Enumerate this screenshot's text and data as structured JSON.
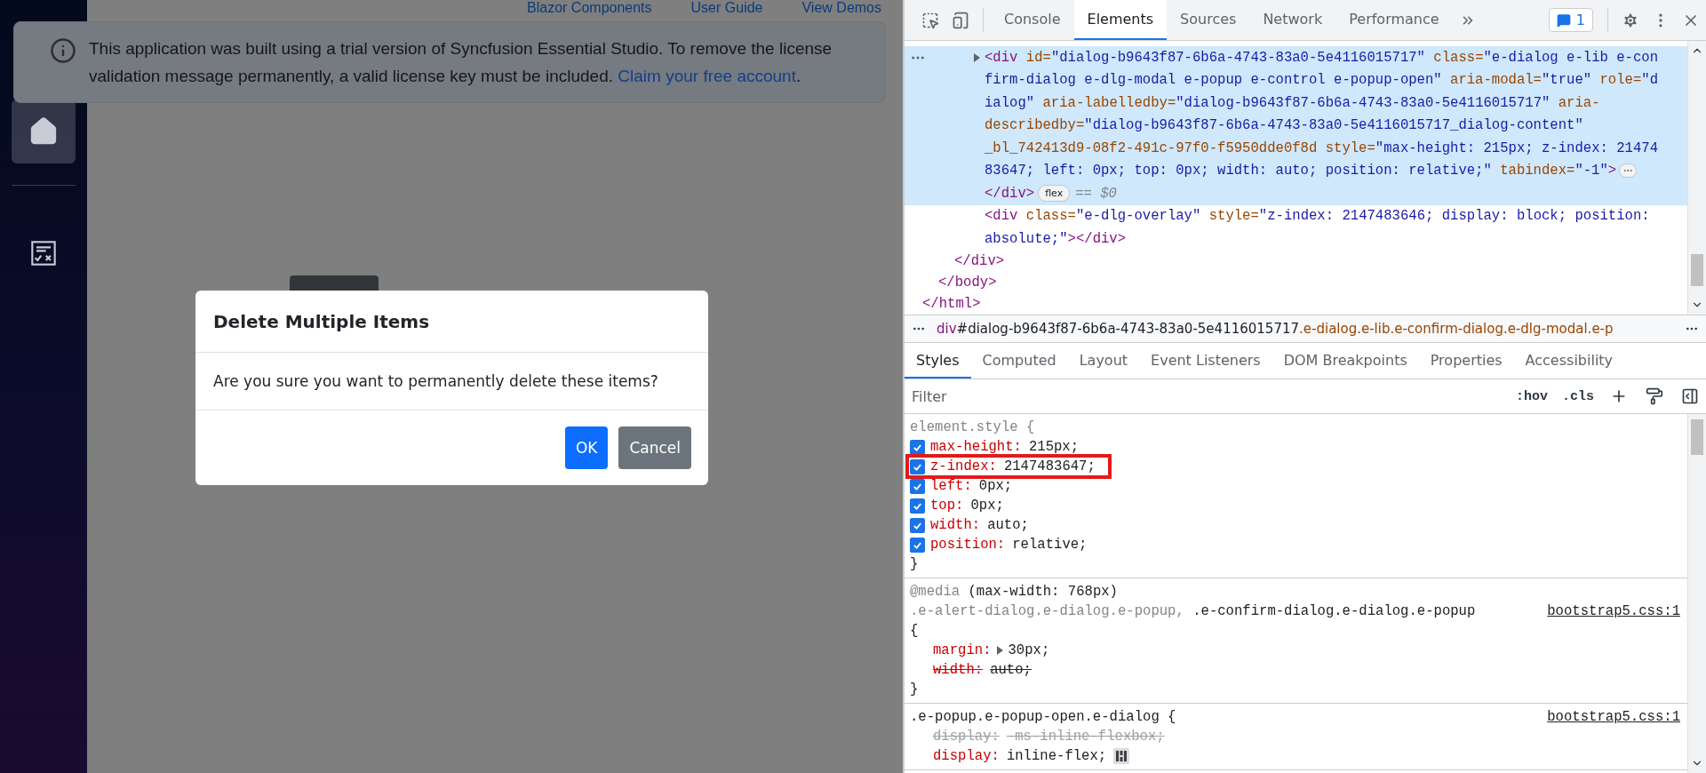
{
  "page": {
    "sidebar": {
      "items": [
        {
          "kind": "home",
          "selected": true
        },
        {
          "kind": "checklist",
          "selected": false
        }
      ]
    },
    "nav_links": [
      "Blazor Components",
      "User Guide",
      "View Demos"
    ],
    "license_notice": {
      "text": "This application was built using a trial version of Syncfusion Essential Studio. To remove the license validation message permanently, a valid license key must be included.",
      "link": "Claim your free account",
      "after": "."
    },
    "dialog": {
      "title": "Delete Multiple Items",
      "message": "Are you sure you want to permanently delete these items?",
      "buttons": [
        {
          "label": "OK",
          "kind": "primary"
        },
        {
          "label": "Cancel",
          "kind": "secondary"
        }
      ]
    }
  },
  "devtools": {
    "tabs": [
      {
        "label": "Console",
        "selected": false
      },
      {
        "label": "Elements",
        "selected": true
      },
      {
        "label": "Sources",
        "selected": false
      },
      {
        "label": "Network",
        "selected": false
      },
      {
        "label": "Performance",
        "selected": false
      }
    ],
    "issues_count": "1",
    "dom_tree": {
      "close": [
        {
          "kind": "tag",
          "text": "</html>"
        }
      ],
      "children": [
        {
          "close": [
            {
              "kind": "tag",
              "text": "</body>"
            }
          ],
          "children": [
            {
              "close": [
                {
                  "kind": "tag",
                  "text": "</div>"
                }
              ],
              "children": [
                {
                  "selected": true,
                  "expanded": false,
                  "truncated": true,
                  "badge": "flex",
                  "marker": "== $0",
                  "lines": [
                    [
                      {
                        "kind": "tag",
                        "text": "<div"
                      },
                      {
                        "kind": "attr",
                        "text": " id="
                      },
                      {
                        "kind": "value",
                        "text": "\"dialog-b9643f87-6b6a-4743-83a0-5e4116015717\""
                      },
                      {
                        "kind": "attr",
                        "text": " class="
                      },
                      {
                        "kind": "value",
                        "text": "\"e-dialog e-lib e-con"
                      }
                    ],
                    [
                      {
                        "kind": "value",
                        "text": "firm-dialog e-dlg-modal e-popup e-control e-popup-open\""
                      },
                      {
                        "kind": "attr",
                        "text": " aria-modal="
                      },
                      {
                        "kind": "value",
                        "text": "\"true\""
                      },
                      {
                        "kind": "attr",
                        "text": " role="
                      },
                      {
                        "kind": "value",
                        "text": "\"d"
                      }
                    ],
                    [
                      {
                        "kind": "value",
                        "text": "ialog\""
                      },
                      {
                        "kind": "attr",
                        "text": " aria-labelledby="
                      },
                      {
                        "kind": "value",
                        "text": "\"dialog-b9643f87-6b6a-4743-83a0-5e4116015717\""
                      },
                      {
                        "kind": "attr",
                        "text": " aria-"
                      }
                    ],
                    [
                      {
                        "kind": "attr",
                        "text": "describedby="
                      },
                      {
                        "kind": "value",
                        "text": "\"dialog-b9643f87-6b6a-4743-83a0-5e4116015717_dialog-content\""
                      }
                    ],
                    [
                      {
                        "kind": "attr",
                        "text": "_bl_742413d9-08f2-491c-97f0-f5950dde0f8d"
                      },
                      {
                        "kind": "attr",
                        "text": " style="
                      },
                      {
                        "kind": "value",
                        "text": "\"max-height: 215px; z-index: 21474"
                      }
                    ],
                    [
                      {
                        "kind": "value",
                        "text": "83647; left: 0px; top: 0px; width: auto; position: relative;\""
                      },
                      {
                        "kind": "attr",
                        "text": " tabindex="
                      },
                      {
                        "kind": "value",
                        "text": "\"-1\""
                      },
                      {
                        "kind": "tag",
                        "text": ">"
                      }
                    ]
                  ],
                  "close": [
                    {
                      "kind": "tag",
                      "text": "</div>"
                    }
                  ]
                },
                {
                  "selected": false,
                  "lines": [
                    [
                      {
                        "kind": "tag",
                        "text": "<div"
                      },
                      {
                        "kind": "attr",
                        "text": " class="
                      },
                      {
                        "kind": "value",
                        "text": "\"e-dlg-overlay\""
                      },
                      {
                        "kind": "attr",
                        "text": " style="
                      },
                      {
                        "kind": "value",
                        "text": "\"z-index: 2147483646; display: block; position:"
                      }
                    ],
                    [
                      {
                        "kind": "value",
                        "text": "absolute;\""
                      },
                      {
                        "kind": "tag",
                        "text": "></div>"
                      }
                    ]
                  ]
                }
              ]
            }
          ]
        }
      ]
    },
    "breadcrumb": {
      "tag": "div",
      "id": "#dialog-b9643f87-6b6a-4743-83a0-5e4116015717",
      "classes": ".e-dialog.e-lib.e-confirm-dialog.e-dlg-modal.e-p"
    },
    "styles_tabs": [
      {
        "label": "Styles",
        "selected": true
      },
      {
        "label": "Computed",
        "selected": false
      },
      {
        "label": "Layout",
        "selected": false
      },
      {
        "label": "Event Listeners",
        "selected": false
      },
      {
        "label": "DOM Breakpoints",
        "selected": false
      },
      {
        "label": "Properties",
        "selected": false
      },
      {
        "label": "Accessibility",
        "selected": false
      }
    ],
    "filter": {
      "placeholder": "Filter"
    },
    "filter_buttons": [
      ":hov",
      ".cls"
    ],
    "rules": [
      {
        "selector": [
          {
            "text": "element.style {",
            "matched": false
          }
        ],
        "close": "}",
        "props": [
          {
            "name": "max-height:",
            "value": "215px;",
            "checked": true,
            "struck": false,
            "supported": true
          },
          {
            "name": "z-index:",
            "value": "2147483647;",
            "checked": true,
            "struck": false,
            "supported": true,
            "annotated": true
          },
          {
            "name": "left:",
            "value": "0px;",
            "checked": true,
            "struck": false,
            "supported": true
          },
          {
            "name": "top:",
            "value": "0px;",
            "checked": true,
            "struck": false,
            "supported": true
          },
          {
            "name": "width:",
            "value": "auto;",
            "checked": true,
            "struck": false,
            "supported": true
          },
          {
            "name": "position:",
            "value": "relative;",
            "checked": true,
            "struck": false,
            "supported": true
          }
        ]
      },
      {
        "media": "@media (max-width: 768px)",
        "selector": [
          {
            "text": ".e-alert-dialog.e-dialog.e-popup, ",
            "matched": false
          },
          {
            "text": ".e-confirm-dialog.e-dialog.e-popup",
            "matched": true
          }
        ],
        "source": "bootstrap5.css:1",
        "open": "{",
        "close": "}",
        "props": [
          {
            "name": "margin:",
            "value": "30px;",
            "struck": false,
            "supported": true,
            "expandable": true
          },
          {
            "name": "width:",
            "value": "auto;",
            "struck": true,
            "supported": true
          }
        ]
      },
      {
        "selector": [
          {
            "text": ".e-popup.e-popup-open.e-dialog {",
            "matched": true
          }
        ],
        "source": "bootstrap5.css:1",
        "props": [
          {
            "name": "display:",
            "value": "-ms-inline-flexbox;",
            "struck": true,
            "supported": false
          },
          {
            "name": "display:",
            "value": "inline-flex;",
            "struck": false,
            "supported": true,
            "flex_editor": true
          }
        ]
      }
    ]
  }
}
